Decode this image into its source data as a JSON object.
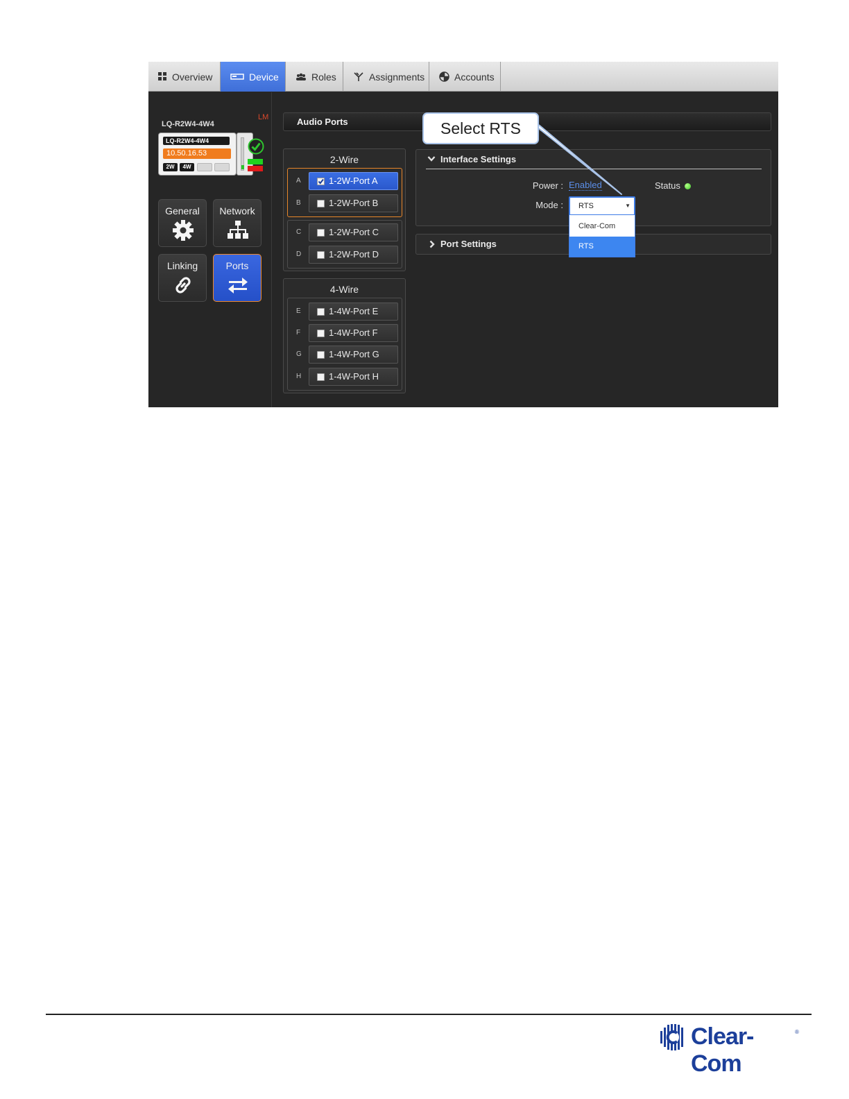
{
  "tabs": [
    {
      "label": "Overview",
      "icon": "grid-icon",
      "active": false
    },
    {
      "label": "Device",
      "icon": "device-icon",
      "active": true
    },
    {
      "label": "Roles",
      "icon": "users-icon",
      "active": false
    },
    {
      "label": "Assignments",
      "icon": "assignments-icon",
      "active": false
    },
    {
      "label": "Accounts",
      "icon": "accounts-icon",
      "active": false
    }
  ],
  "device": {
    "name": "LQ-R2W4-4W4",
    "badge": "LM",
    "card_name": "LQ-R2W4-4W4",
    "ip": "10.50.16.53",
    "chips": [
      "2W",
      "4W"
    ]
  },
  "nav": [
    {
      "label": "General",
      "icon": "gear-icon",
      "active": false
    },
    {
      "label": "Network",
      "icon": "network-icon",
      "active": false
    },
    {
      "label": "Linking",
      "icon": "link-icon",
      "active": false
    },
    {
      "label": "Ports",
      "icon": "swap-arrows-icon",
      "active": true
    }
  ],
  "audio_ports": {
    "title": "Audio Ports",
    "two_wire": {
      "title": "2-Wire",
      "ports": [
        {
          "letter": "A",
          "label": "1-2W-Port A",
          "checked": true
        },
        {
          "letter": "B",
          "label": "1-2W-Port B",
          "checked": false
        },
        {
          "letter": "C",
          "label": "1-2W-Port C",
          "checked": false
        },
        {
          "letter": "D",
          "label": "1-2W-Port D",
          "checked": false
        }
      ]
    },
    "four_wire": {
      "title": "4-Wire",
      "ports": [
        {
          "letter": "E",
          "label": "1-4W-Port E",
          "checked": false
        },
        {
          "letter": "F",
          "label": "1-4W-Port F",
          "checked": false
        },
        {
          "letter": "G",
          "label": "1-4W-Port G",
          "checked": false
        },
        {
          "letter": "H",
          "label": "1-4W-Port H",
          "checked": false
        }
      ]
    }
  },
  "interface_settings": {
    "title": "Interface Settings",
    "power_label": "Power :",
    "power_value": "Enabled",
    "status_label": "Status",
    "status_color": "#3cc828",
    "mode_label": "Mode :",
    "mode_value": "RTS",
    "mode_options": [
      "Clear-Com",
      "RTS"
    ],
    "mode_selected": "RTS"
  },
  "port_settings": {
    "title": "Port Settings"
  },
  "callout": {
    "text": "Select RTS"
  },
  "footer": {
    "logo_text": "Clear-Com",
    "logo_mark": "®"
  },
  "colors": {
    "accent": "#3f6fd8",
    "selection_outline": "#e8862a",
    "ip_badge": "#f07c1e"
  }
}
